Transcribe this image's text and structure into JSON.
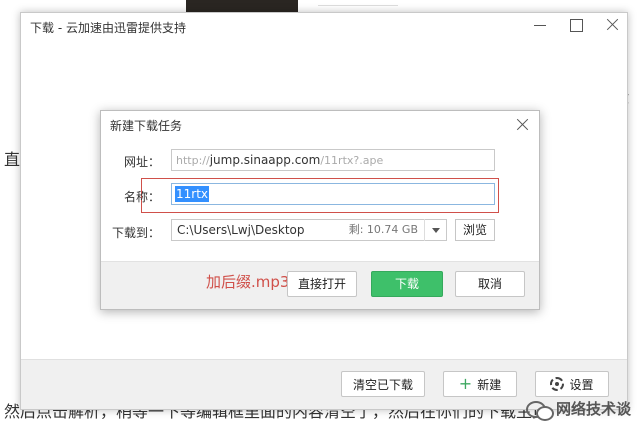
{
  "background": {
    "left_char": "直",
    "bottom_text": "然后点击解析，稍等一下等编辑框里面的内容清空了，然后在你们的下载主页",
    "right_scrap": "·-\ny\n,"
  },
  "watermark": {
    "label": "网络技术谈"
  },
  "main_window": {
    "title": "下载 - 云加速由迅雷提供支持",
    "footer": {
      "clear_label": "清空已下载",
      "new_label": "新建",
      "settings_label": "设置"
    }
  },
  "dialog": {
    "title": "新建下载任务",
    "url_label": "网址：",
    "url_prefix": "http://",
    "url_host": "jump.sinaapp.com",
    "url_path": "/11rtx?.ape",
    "name_label": "名称：",
    "name_value": "11rtx",
    "dir_label": "下载到：",
    "dir_path": "C:\\Users\\Lwj\\Desktop",
    "dir_free": "剩: 10.74 GB",
    "browse_label": "浏览",
    "annotation": "加后缀.mp3",
    "open_label": "直接打开",
    "download_label": "下载",
    "cancel_label": "取消"
  },
  "colors": {
    "download_green": "#3ec06a",
    "annotation_red": "#d0504a",
    "selection_blue": "#3390ff"
  },
  "icons": [
    "minimize-icon",
    "maximize-icon",
    "close-icon",
    "plus-icon",
    "gear-icon",
    "dropdown-caret-icon",
    "wechat-icon"
  ]
}
